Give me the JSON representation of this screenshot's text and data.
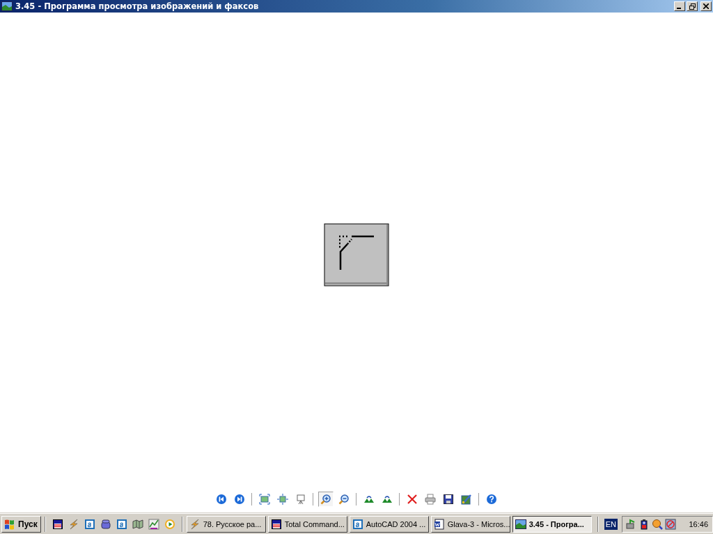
{
  "window": {
    "title": "3.45 - Программа просмотра изображений и факсов"
  },
  "toolbar": {
    "groups": [
      [
        {
          "kind": "previous",
          "pressed": false
        },
        {
          "kind": "next",
          "pressed": false
        }
      ],
      [
        {
          "kind": "best-fit",
          "pressed": false
        },
        {
          "kind": "actual-size",
          "pressed": false
        },
        {
          "kind": "slideshow",
          "pressed": false
        }
      ],
      [
        {
          "kind": "zoom-in",
          "pressed": true
        },
        {
          "kind": "zoom-out",
          "pressed": false
        }
      ],
      [
        {
          "kind": "rotate-cw",
          "pressed": false
        },
        {
          "kind": "rotate-ccw",
          "pressed": false
        }
      ],
      [
        {
          "kind": "delete",
          "pressed": false
        },
        {
          "kind": "print",
          "pressed": false
        },
        {
          "kind": "save",
          "pressed": false
        },
        {
          "kind": "edit",
          "pressed": false
        }
      ],
      [
        {
          "kind": "help",
          "pressed": false
        }
      ]
    ]
  },
  "taskbar": {
    "start": "Пуск",
    "quick_launch": [
      {
        "kind": "floppy"
      },
      {
        "kind": "bolt"
      },
      {
        "kind": "letter-a"
      },
      {
        "kind": "phone"
      },
      {
        "kind": "letter-a"
      },
      {
        "kind": "map"
      },
      {
        "kind": "chart"
      },
      {
        "kind": "player"
      }
    ],
    "tasks": [
      {
        "label": "78. Русское ра...",
        "selected": false
      },
      {
        "label": "Total Command...",
        "selected": false
      },
      {
        "label": "AutoCAD 2004 ...",
        "selected": false
      },
      {
        "label": "Glava-3 - Micros...",
        "selected": false
      },
      {
        "label": "3.45 - Програ...",
        "selected": true
      }
    ],
    "language": "EN",
    "tray": [
      {
        "kind": "network"
      },
      {
        "kind": "battery"
      },
      {
        "kind": "magnifier"
      },
      {
        "kind": "blocked"
      }
    ],
    "clock": "16:46"
  }
}
